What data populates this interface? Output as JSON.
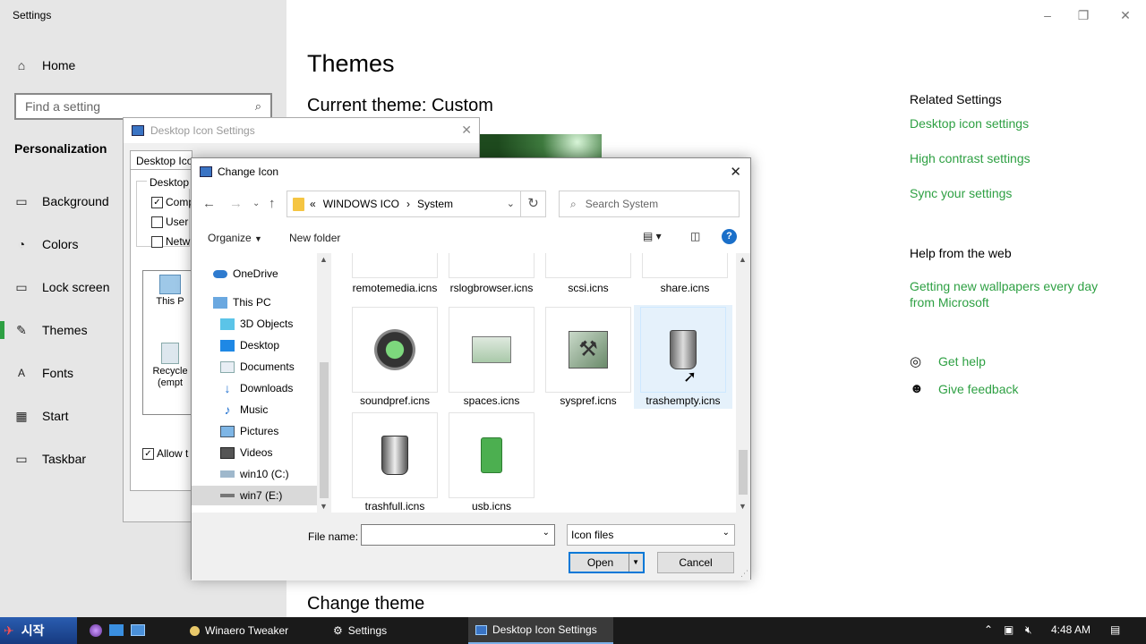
{
  "settings": {
    "app_title": "Settings",
    "home": "Home",
    "search_placeholder": "Find a setting",
    "section": "Personalization",
    "nav": [
      {
        "label": "Background",
        "icon": "picture-icon"
      },
      {
        "label": "Colors",
        "icon": "palette-icon"
      },
      {
        "label": "Lock screen",
        "icon": "lock-screen-icon"
      },
      {
        "label": "Themes",
        "icon": "brush-icon"
      },
      {
        "label": "Fonts",
        "icon": "font-icon"
      },
      {
        "label": "Start",
        "icon": "start-icon"
      },
      {
        "label": "Taskbar",
        "icon": "taskbar-icon"
      }
    ],
    "page_title": "Themes",
    "current_theme": "Current theme: Custom",
    "change_theme": "Change theme",
    "related_title": "Related Settings",
    "related_links": [
      "Desktop icon settings",
      "High contrast settings",
      "Sync your settings"
    ],
    "help_title": "Help from the web",
    "help_link": "Getting new wallpapers every day from Microsoft",
    "get_help": "Get help",
    "give_feedback": "Give feedback",
    "accent_color": "#2ea043"
  },
  "desktop_icon_settings": {
    "title": "Desktop Icon Settings",
    "tab": "Desktop Icon",
    "group_label": "Desktop i",
    "checkboxes": [
      {
        "label": "Comp",
        "checked": true
      },
      {
        "label": "User",
        "checked": false
      },
      {
        "label": "Netw",
        "checked": false
      }
    ],
    "icons": [
      "This P",
      "Recycle (empt"
    ],
    "allow_label": "Allow t",
    "allow_checked": true
  },
  "change_icon": {
    "title": "Change Icon",
    "breadcrumb": [
      "WINDOWS ICO",
      "System"
    ],
    "breadcrumb_prefix": "«",
    "search_placeholder": "Search System",
    "organize": "Organize",
    "new_folder": "New folder",
    "tree": [
      {
        "label": "OneDrive",
        "icon": "onedrive-icon"
      },
      {
        "label": "This PC",
        "icon": "pc-icon"
      },
      {
        "label": "3D Objects",
        "icon": "3d-objects-icon"
      },
      {
        "label": "Desktop",
        "icon": "desktop-icon"
      },
      {
        "label": "Documents",
        "icon": "documents-icon"
      },
      {
        "label": "Downloads",
        "icon": "downloads-icon"
      },
      {
        "label": "Music",
        "icon": "music-icon"
      },
      {
        "label": "Pictures",
        "icon": "pictures-icon"
      },
      {
        "label": "Videos",
        "icon": "videos-icon"
      },
      {
        "label": "win10 (C:)",
        "icon": "drive-icon"
      },
      {
        "label": "win7 (E:)",
        "icon": "drive-icon"
      }
    ],
    "files_row1": [
      "remotemedia.icns",
      "rslogbrowser.icns",
      "scsi.icns",
      "share.icns"
    ],
    "files_row2": [
      "soundpref.icns",
      "spaces.icns",
      "syspref.icns",
      "trashempty.icns"
    ],
    "files_row3": [
      "trashfull.icns",
      "usb.icns"
    ],
    "selected_file": "trashempty.icns",
    "file_name_label": "File name:",
    "file_name_value": "",
    "file_type": "Icon files",
    "open": "Open",
    "cancel": "Cancel"
  },
  "taskbar": {
    "start": "시작",
    "apps": [
      "Winaero Tweaker",
      "Settings",
      "Desktop Icon Settings"
    ],
    "active_app": "Desktop Icon Settings",
    "time": "4:48 AM"
  }
}
